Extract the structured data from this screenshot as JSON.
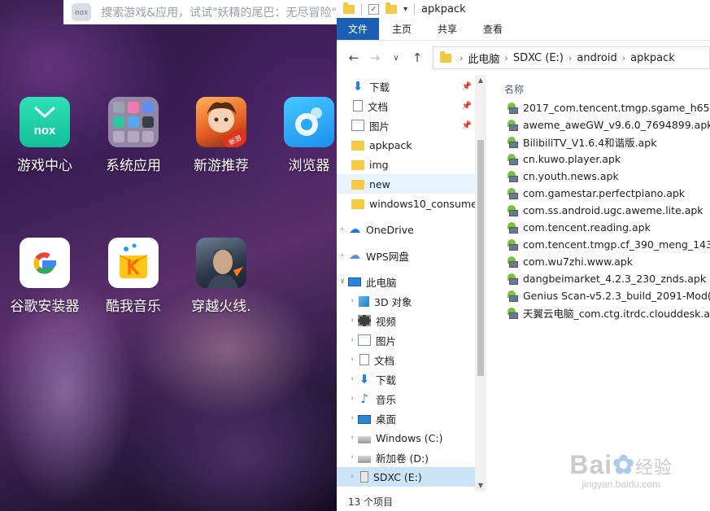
{
  "emulator": {
    "search_placeholder": "搜索游戏&应用，试试\"妖精的尾巴：无尽冒险\"",
    "nox_logo_text": "nox",
    "apps": [
      {
        "label": "游戏中心",
        "icon": "nox-game-center-icon"
      },
      {
        "label": "系统应用",
        "icon": "system-apps-folder-icon"
      },
      {
        "label": "新游推荐",
        "icon": "new-games-icon"
      },
      {
        "label": "浏览器",
        "icon": "browser-icon"
      },
      {
        "label": "谷歌安装器",
        "icon": "google-installer-icon"
      },
      {
        "label": "酷我音乐",
        "icon": "kuwo-music-icon"
      },
      {
        "label": "穿越火线.",
        "icon": "crossfire-icon"
      }
    ],
    "new_badge": "新游"
  },
  "explorer": {
    "window_title": "apkpack",
    "ribbon_tabs": [
      "文件",
      "主页",
      "共享",
      "查看"
    ],
    "address": {
      "crumbs": [
        "此电脑",
        "SDXC (E:)",
        "android",
        "apkpack"
      ]
    },
    "nav_items": [
      {
        "label": "下载",
        "icon": "download-icon",
        "pinned": true
      },
      {
        "label": "文档",
        "icon": "document-icon",
        "pinned": true
      },
      {
        "label": "图片",
        "icon": "picture-icon",
        "pinned": true
      },
      {
        "label": "apkpack",
        "icon": "folder-icon"
      },
      {
        "label": "img",
        "icon": "folder-icon"
      },
      {
        "label": "new",
        "icon": "folder-icon"
      },
      {
        "label": "windows10_consume",
        "icon": "folder-icon"
      },
      {
        "label": "OneDrive",
        "icon": "onedrive-icon"
      },
      {
        "label": "WPS网盘",
        "icon": "wps-cloud-icon"
      },
      {
        "label": "此电脑",
        "icon": "this-pc-icon"
      },
      {
        "label": "3D 对象",
        "icon": "3d-objects-icon"
      },
      {
        "label": "视频",
        "icon": "video-icon"
      },
      {
        "label": "图片",
        "icon": "picture-icon"
      },
      {
        "label": "文档",
        "icon": "document-icon"
      },
      {
        "label": "下载",
        "icon": "download-icon"
      },
      {
        "label": "音乐",
        "icon": "music-icon"
      },
      {
        "label": "桌面",
        "icon": "desktop-icon"
      },
      {
        "label": "Windows (C:)",
        "icon": "drive-icon"
      },
      {
        "label": "新加卷 (D:)",
        "icon": "drive-icon"
      },
      {
        "label": "SDXC (E:)",
        "icon": "sd-card-icon"
      }
    ],
    "column_header": "名称",
    "files": [
      "2017_com.tencent.tmgp.sgame_h652...",
      "aweme_aweGW_v9.6.0_7694899.apk",
      "BilibiliTV_V1.6.4和谐版.apk",
      "cn.kuwo.player.apk",
      "cn.youth.news.apk",
      "com.gamestar.perfectpiano.apk",
      "com.ss.android.ugc.aweme.lite.apk",
      "com.tencent.reading.apk",
      "com.tencent.tmgp.cf_390_meng_1439...",
      "com.wu7zhi.www.apk",
      "dangbeimarket_4.2.3_230_znds.apk",
      "Genius Scan-v5.2.3_build_2091-Mod(...",
      "天翼云电脑_com.ctg.itrdc.clouddesk.a..."
    ],
    "status_text": "13 个项目"
  },
  "watermark": {
    "main": "Bai",
    "cn": "经验",
    "sub": "jingyan.baidu.com"
  }
}
